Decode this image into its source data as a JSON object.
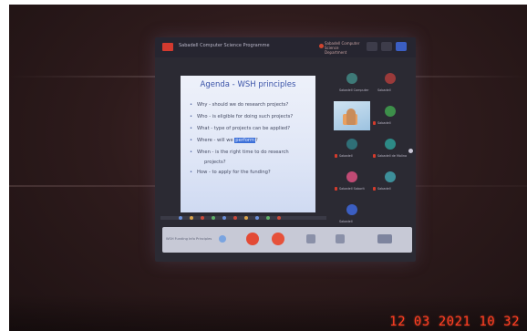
{
  "meeting": {
    "topbar_title": "Sabadell Computer Science Programme",
    "topbar_user": "Sabadell Computer Science Department",
    "control_label": "WSH Funding Info Principles"
  },
  "slide": {
    "title": "Agenda - WSH principles",
    "bullets": [
      {
        "text": "Why - should we do research projects?"
      },
      {
        "text": "Who - is eligible for doing such projects?"
      },
      {
        "text": "What - type of projects can be applied?"
      },
      {
        "text_before": "Where - will we ",
        "highlight": "perform",
        "text_after": "?"
      },
      {
        "text": "When - is the right time to do research"
      },
      {
        "text": "projects?",
        "indent": true
      },
      {
        "text": "How - to apply for the funding?"
      }
    ]
  },
  "participants": [
    {
      "name": "Sabadell Computer",
      "avatar_color": "#3e7a78",
      "muted": false
    },
    {
      "name": "Sabadell",
      "avatar_color": "#9a3a3a",
      "muted": false
    },
    {
      "name": "",
      "avatar_color": "",
      "muted": false,
      "video": true
    },
    {
      "name": "Sabadell",
      "avatar_color": "#3d8f4a",
      "muted": true
    },
    {
      "name": "Sabadell",
      "avatar_color": "#2f6f77",
      "muted": true
    },
    {
      "name": "Sabadell de Molina",
      "avatar_color": "#2d8a86",
      "muted": true
    },
    {
      "name": "Sabadell Saborit",
      "avatar_color": "#c04a74",
      "muted": true
    },
    {
      "name": "Sabadell",
      "avatar_color": "#3d8f9a",
      "muted": true
    },
    {
      "name": "Sabadell",
      "avatar_color": "#3b5ec2",
      "muted": false
    }
  ],
  "colors": {
    "record": "#d23a2f",
    "mic_off": "#e34a35",
    "stamp": "#ff3d22",
    "active_view": "#3b5ec2"
  },
  "datestamp": "12 03 2021 10 32"
}
